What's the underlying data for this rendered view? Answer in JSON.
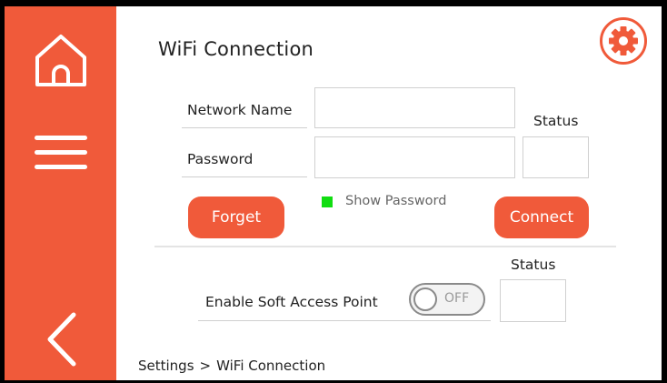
{
  "page": {
    "title": "WiFi Connection",
    "accent_color": "#f05a3a"
  },
  "sidebar": {
    "home_icon": "home-icon",
    "menu_icon": "hamburger-menu-icon",
    "back_icon": "back-arrow-icon"
  },
  "header": {
    "settings_icon": "gear-icon"
  },
  "wifi": {
    "network_name_label": "Network Name",
    "network_name_value": "",
    "password_label": "Password",
    "password_value": "",
    "status_label": "Status",
    "status_value": "",
    "show_password_label": "Show Password",
    "show_password_checked": true,
    "forget_label": "Forget",
    "connect_label": "Connect"
  },
  "soft_ap": {
    "label": "Enable Soft Access Point",
    "toggle_text": "OFF",
    "toggle_on": false,
    "status_label": "Status",
    "status_value": ""
  },
  "breadcrumb": {
    "parent": "Settings",
    "separator": ">",
    "current": "WiFi Connection"
  }
}
